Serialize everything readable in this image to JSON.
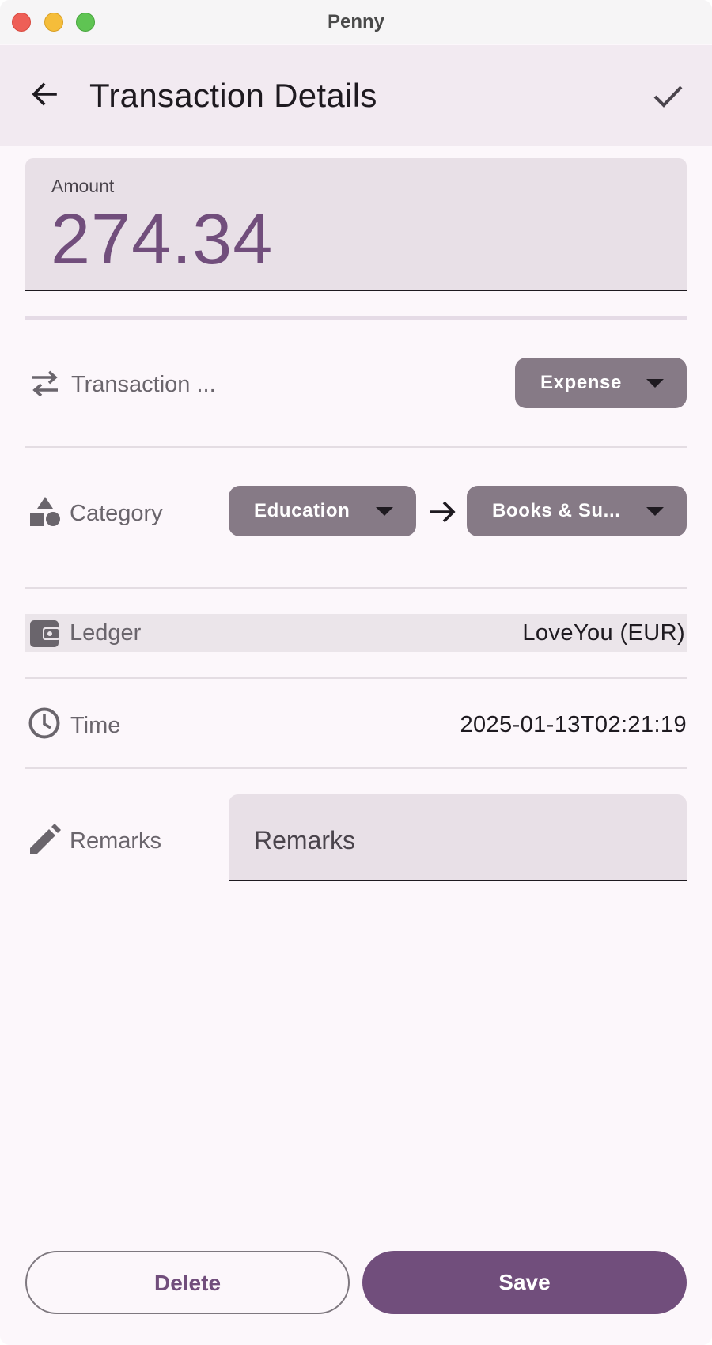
{
  "window": {
    "title": "Penny"
  },
  "appbar": {
    "title": "Transaction Details"
  },
  "amount": {
    "label": "Amount",
    "value": "274.34"
  },
  "transaction_type": {
    "label": "Transaction ...",
    "value": "Expense"
  },
  "category": {
    "label": "Category",
    "primary": "Education",
    "secondary": "Books & Su..."
  },
  "ledger": {
    "label": "Ledger",
    "value": "LoveYou (EUR)"
  },
  "time": {
    "label": "Time",
    "value": "2025-01-13T02:21:19"
  },
  "remarks": {
    "label": "Remarks",
    "placeholder": "Remarks"
  },
  "buttons": {
    "delete": "Delete",
    "save": "Save"
  },
  "colors": {
    "accent": "#714e7c",
    "dropdown": "#867a86",
    "field_bg": "#e8e0e7",
    "appbar_bg": "#f2eaf1"
  },
  "icons": {
    "back": "arrow-left-icon",
    "confirm": "check-icon",
    "type": "swap-horizontal-icon",
    "category": "shapes-icon",
    "ledger": "wallet-icon",
    "time": "clock-icon",
    "remarks": "pencil-icon"
  }
}
